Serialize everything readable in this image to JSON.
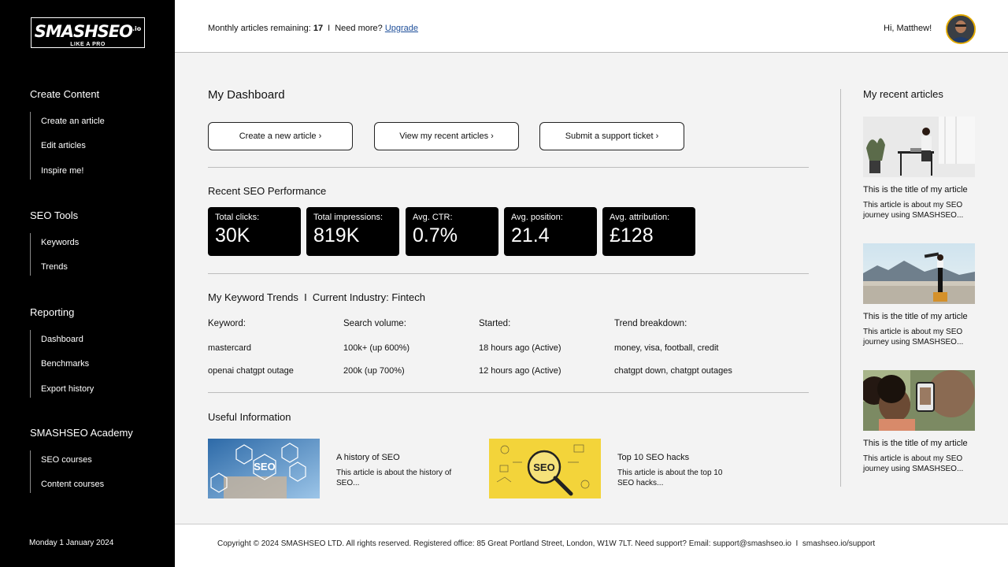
{
  "sidebar": {
    "logo": {
      "main": "SMASHSEO",
      "suffix": ".io",
      "tagline": "LIKE A PRO"
    },
    "sections": [
      {
        "title": "Create Content",
        "items": [
          "Create an article",
          "Edit articles",
          "Inspire me!"
        ]
      },
      {
        "title": "SEO Tools",
        "items": [
          "Keywords",
          "Trends"
        ]
      },
      {
        "title": "Reporting",
        "items": [
          "Dashboard",
          "Benchmarks",
          "Export history"
        ]
      },
      {
        "title": "SMASHSEO Academy",
        "items": [
          "SEO courses",
          "Content courses"
        ]
      }
    ],
    "date": "Monday 1 January 2024"
  },
  "topbar": {
    "articles_label": "Monthly articles remaining:",
    "articles_count": "17",
    "separator": "I",
    "need_more": "Need more?",
    "upgrade": "Upgrade",
    "greeting": "Hi, Matthew!"
  },
  "main": {
    "title": "My Dashboard",
    "actions": [
      "Create a new article ›",
      "View my recent articles ›",
      "Submit a support ticket ›"
    ],
    "seo": {
      "title": "Recent SEO Performance",
      "stats": [
        {
          "label": "Total clicks:",
          "value": "30K"
        },
        {
          "label": "Total impressions:",
          "value": "819K"
        },
        {
          "label": "Avg. CTR:",
          "value": "0.7%"
        },
        {
          "label": "Avg. position:",
          "value": "21.4"
        },
        {
          "label": "Avg. attribution:",
          "value": "£128"
        }
      ]
    },
    "keywords": {
      "title": "My Keyword Trends  I  Current Industry: Fintech",
      "headers": [
        "Keyword:",
        "Search volume:",
        "Started:",
        "Trend breakdown:"
      ],
      "rows": [
        [
          "mastercard",
          "100k+ (up 600%)",
          "18 hours ago (Active)",
          "money, visa, football, credit"
        ],
        [
          "openai chatgpt outage",
          "200k (up 700%)",
          "12 hours ago (Active)",
          "chatgpt down, chatgpt outages"
        ]
      ]
    },
    "useful": {
      "title": "Useful Information",
      "items": [
        {
          "title": "A history of SEO",
          "desc": "This article is about the history of SEO...",
          "image_text": "SEO"
        },
        {
          "title": "Top 10 SEO hacks",
          "desc": "This article is about the top 10 SEO hacks...",
          "image_text": "SEO"
        }
      ]
    }
  },
  "recent": {
    "title": "My recent articles",
    "items": [
      {
        "title": "This is the title of my article",
        "desc": "This article is about my SEO journey using SMASHSEO..."
      },
      {
        "title": "This is the title of my article",
        "desc": "This article is about my SEO journey using SMASHSEO..."
      },
      {
        "title": "This is the title of my article",
        "desc": "This article is about my SEO journey using SMASHSEO..."
      }
    ]
  },
  "footer": {
    "text": "Copyright © 2024 SMASHSEO LTD. All rights reserved. Registered office: 85 Great Portland Street, London, W1W 7LT. Need support? Email: support@smashseo.io  I  smashseo.io/support"
  },
  "colors": {
    "sidebar_bg": "#000000",
    "card_bg": "#000000",
    "link": "#1f4f9a",
    "main_bg": "#f3f3f3"
  }
}
